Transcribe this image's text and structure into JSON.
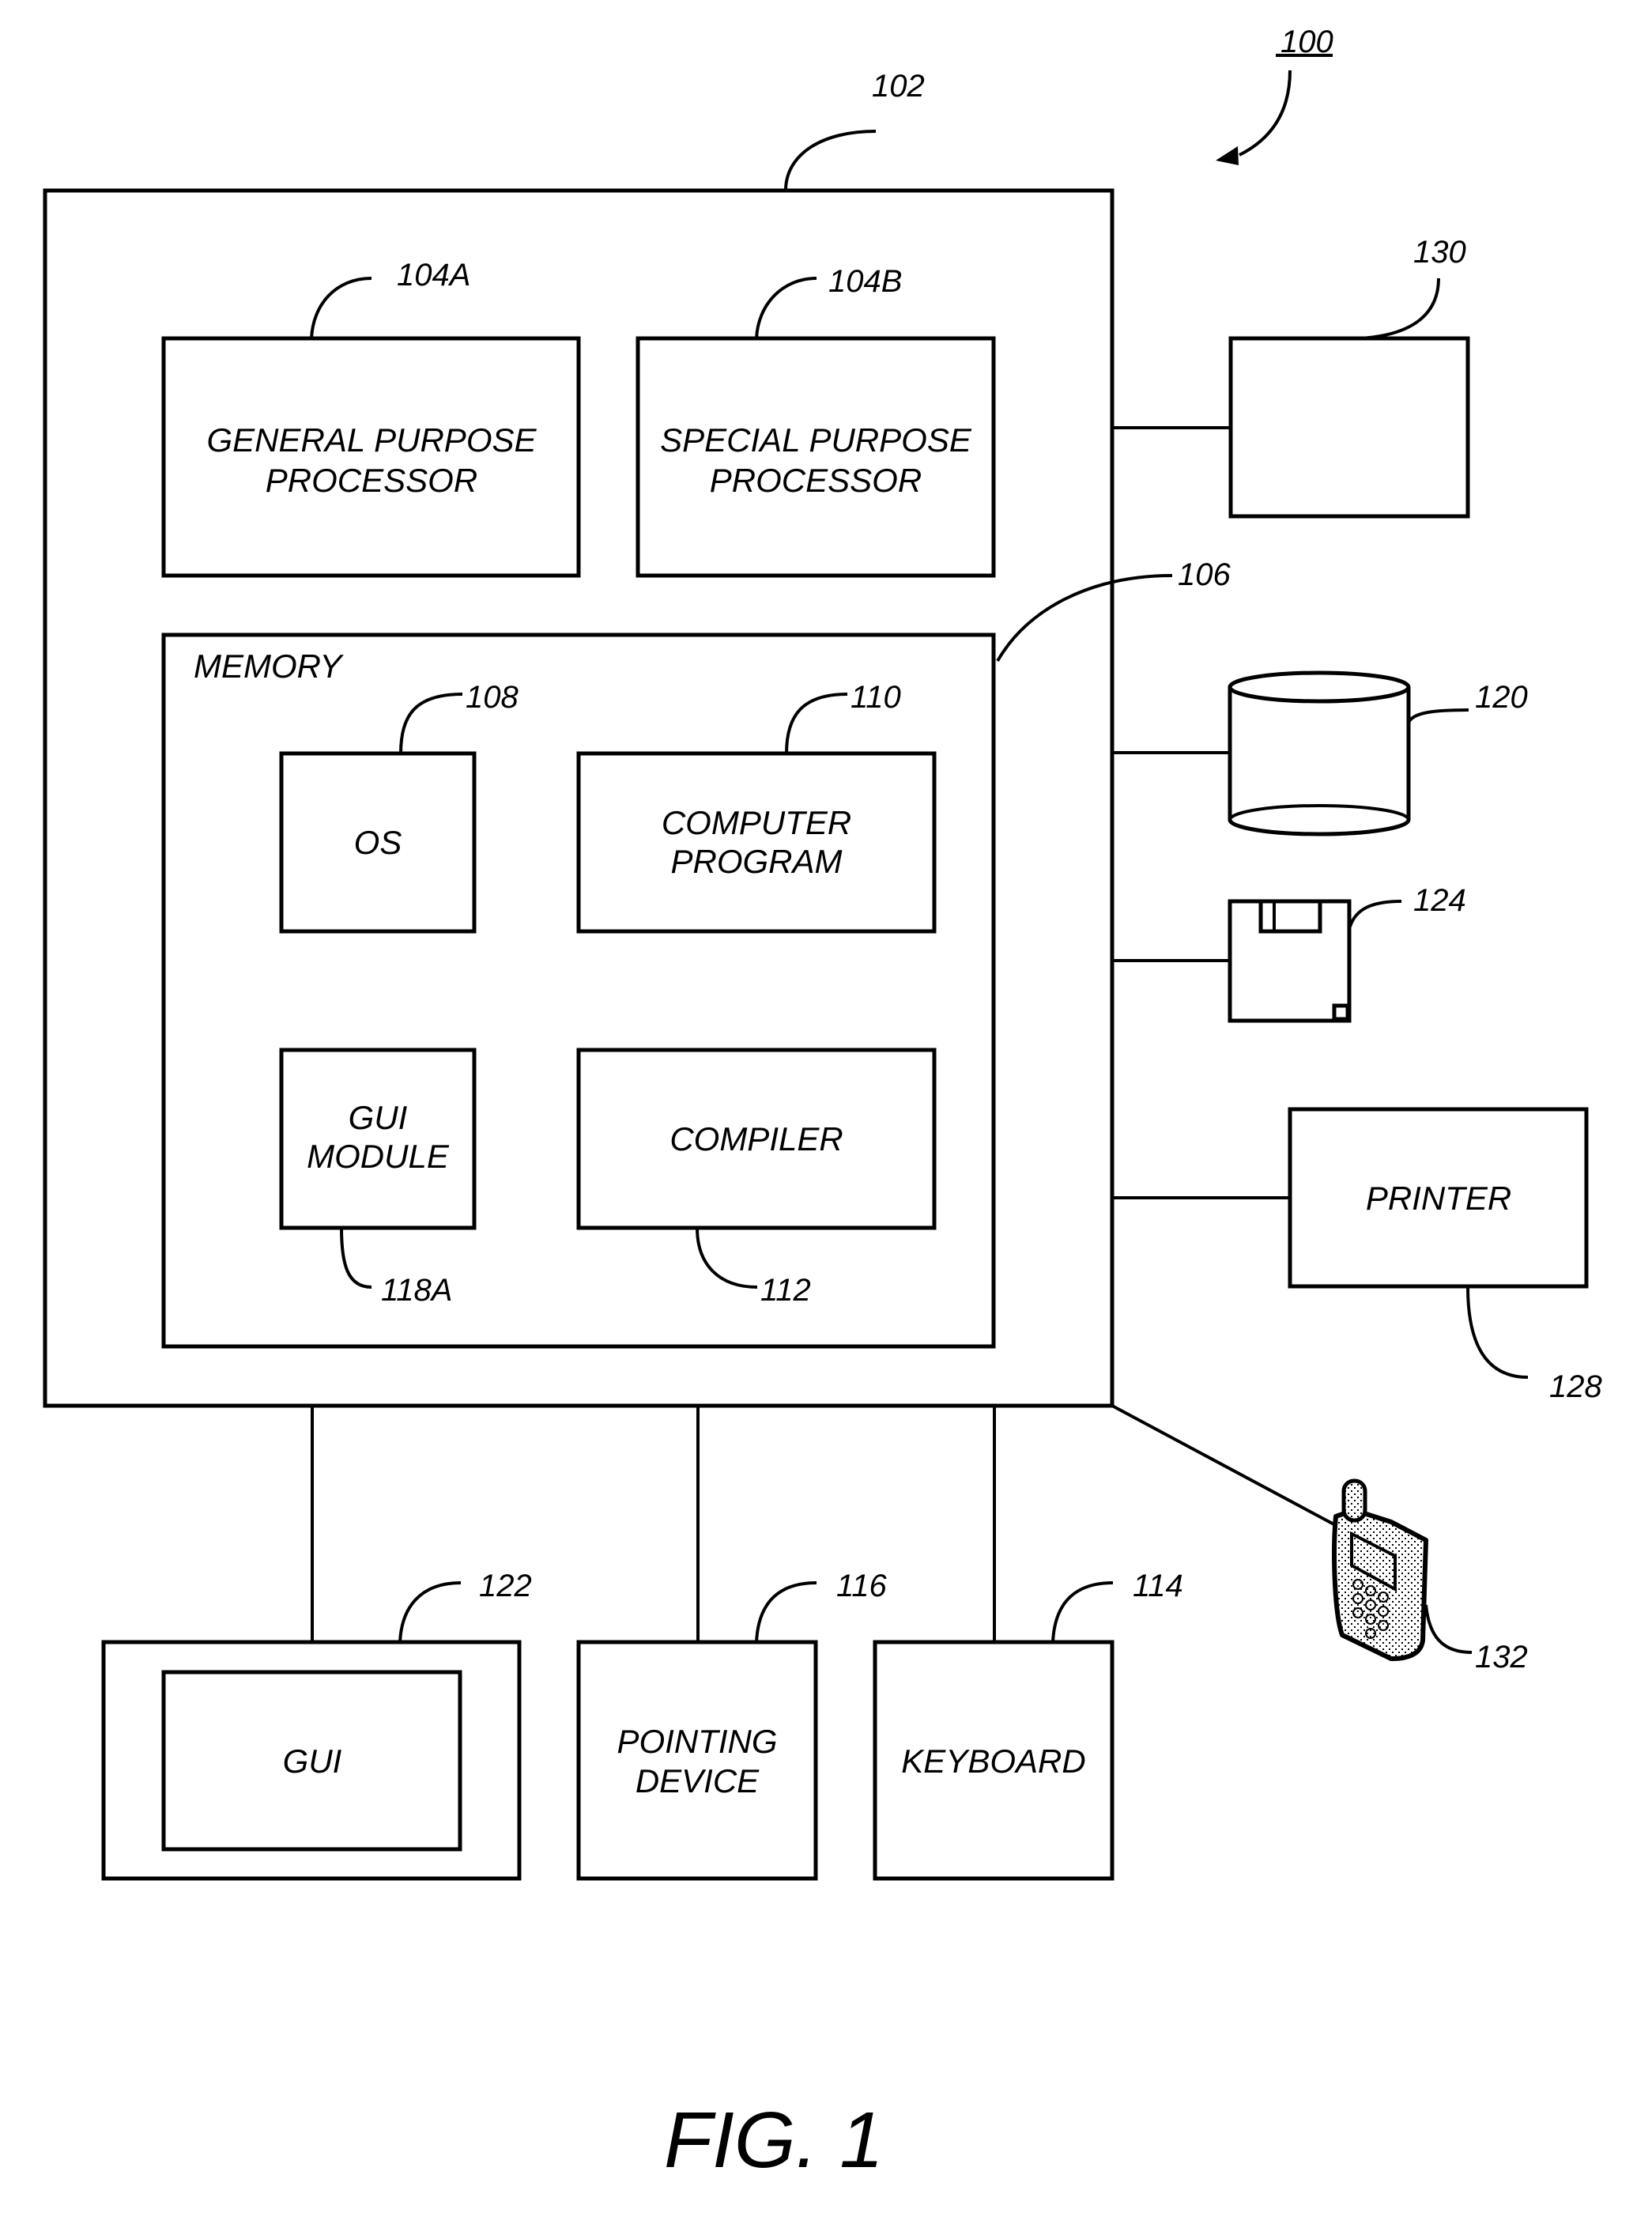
{
  "figure": {
    "caption": "FIG. 1",
    "system_ref": "100"
  },
  "computer": {
    "ref": "102",
    "processors": [
      {
        "ref": "104A",
        "lines": [
          "GENERAL PURPOSE",
          "PROCESSOR"
        ]
      },
      {
        "ref": "104B",
        "lines": [
          "SPECIAL PURPOSE",
          "PROCESSOR"
        ]
      }
    ],
    "memory": {
      "ref": "106",
      "label": "MEMORY",
      "modules": [
        {
          "ref": "108",
          "lines": [
            "OS"
          ]
        },
        {
          "ref": "110",
          "lines": [
            "COMPUTER",
            "PROGRAM"
          ]
        },
        {
          "ref": "118A",
          "lines": [
            "GUI",
            "MODULE"
          ]
        },
        {
          "ref": "112",
          "lines": [
            "COMPILER"
          ]
        }
      ]
    }
  },
  "peripherals": {
    "unlabeled_device": {
      "ref": "130"
    },
    "data_storage": {
      "ref": "120",
      "icon": "database-cylinder-icon"
    },
    "removable_storage": {
      "ref": "124",
      "icon": "floppy-disk-icon"
    },
    "printer": {
      "ref": "128",
      "lines": [
        "PRINTER"
      ]
    },
    "mobile_device": {
      "ref": "132",
      "icon": "mobile-phone-icon"
    },
    "display": {
      "ref": "122",
      "lines": [
        "GUI"
      ]
    },
    "pointing_device": {
      "ref": "116",
      "lines": [
        "POINTING",
        "DEVICE"
      ]
    },
    "keyboard": {
      "ref": "114",
      "lines": [
        "KEYBOARD"
      ]
    }
  },
  "colors": {
    "stroke": "#000000",
    "background": "#ffffff"
  }
}
